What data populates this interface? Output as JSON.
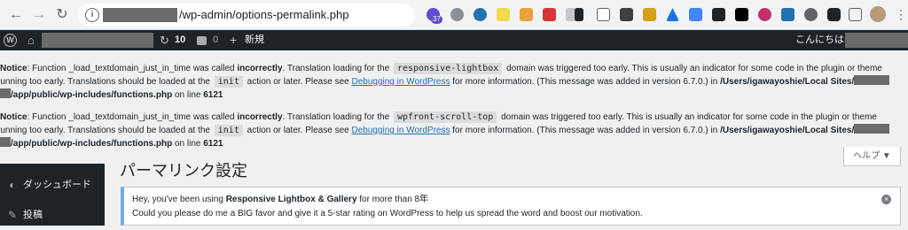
{
  "browser": {
    "url": "/wp-admin/options-permalink.php",
    "extension_badge": "37"
  },
  "adminbar": {
    "updates_count": "10",
    "comments_count": "0",
    "new_label": "新規",
    "greeting": "こんにちは、"
  },
  "notices": [
    {
      "label": "Notice",
      "pre": ": Function _load_textdomain_just_in_time was called ",
      "strong": "incorrectly",
      "mid1": ". Translation loading for the ",
      "domain": "responsive-lightbox",
      "mid2": " domain was triggered too early. This is usually an indicator for some code in the plugin or theme",
      "line2_pre": "running too early. Translations should be loaded at the ",
      "init": "init",
      "line2_mid": " action or later. Please see ",
      "link": "Debugging in WordPress",
      "line2_post": " for more information. (This message was added in version 6.7.0.) in ",
      "path1": "/Users/igawayoshie/Local Sites/",
      "path2": "/app/public/wp-includes/functions.php",
      "online": " on line ",
      "line_no": "6121"
    },
    {
      "label": "Notice",
      "pre": ": Function _load_textdomain_just_in_time was called ",
      "strong": "incorrectly",
      "mid1": ". Translation loading for the ",
      "domain": "wpfront-scroll-top",
      "mid2": " domain was triggered too early. This is usually an indicator for some code in the plugin or theme",
      "line2_pre": "running too early. Translations should be loaded at the ",
      "init": "init",
      "line2_mid": " action or later. Please see ",
      "link": "Debugging in WordPress",
      "line2_post": " for more information. (This message was added in version 6.7.0.) in ",
      "path1": "/Users/igawayoshie/Local Sites/",
      "path2": "/app/public/wp-includes/functions.php",
      "online": " on line ",
      "line_no": "6121"
    }
  ],
  "sidebar": {
    "items": [
      {
        "label": "ダッシュボード",
        "icon": "dashboard-icon"
      },
      {
        "label": "投稿",
        "icon": "pin-icon"
      }
    ]
  },
  "page": {
    "title": "パーマリンク設定",
    "help_label": "ヘルプ ▼"
  },
  "rlg_notice": {
    "line1_pre": "Hey, you've been using ",
    "plugin": "Responsive Lightbox & Gallery",
    "line1_post": " for more than 8年",
    "line2": "Could you please do me a BIG favor and give it a 5-star rating on WordPress to help us spread the word and boost our motivation."
  }
}
